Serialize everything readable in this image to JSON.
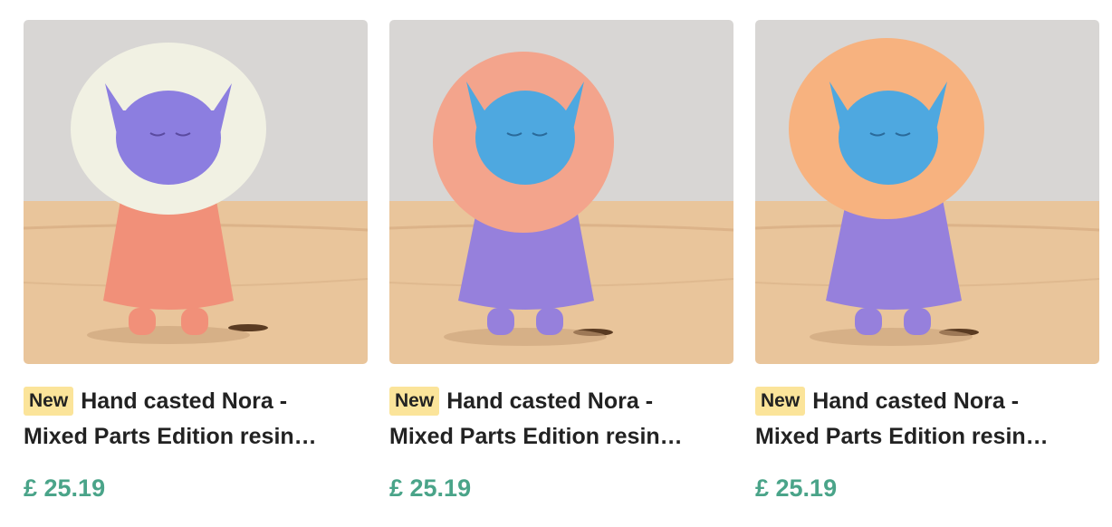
{
  "products": [
    {
      "badge": "New",
      "title_line1": "Hand casted Nora -",
      "title_line2": "Mixed Parts Edition resin…",
      "price": "£ 25.19",
      "image_colors": {
        "head": "#8c7ee0",
        "collar": "#f1f1e3",
        "body": "#f19079"
      }
    },
    {
      "badge": "New",
      "title_line1": "Hand casted Nora -",
      "title_line2": "Mixed Parts Edition resin…",
      "price": "£ 25.19",
      "image_colors": {
        "head": "#4ea8e0",
        "collar": "#f3a48c",
        "body": "#9680dc"
      }
    },
    {
      "badge": "New",
      "title_line1": "Hand casted Nora -",
      "title_line2": "Mixed Parts Edition resin…",
      "price": "£ 25.19",
      "image_colors": {
        "head": "#4ea8e0",
        "collar": "#f7b27f",
        "body": "#9680dc"
      }
    }
  ],
  "colors": {
    "badge_bg": "#fbe49a",
    "price": "#4aa489",
    "text": "#222222"
  }
}
